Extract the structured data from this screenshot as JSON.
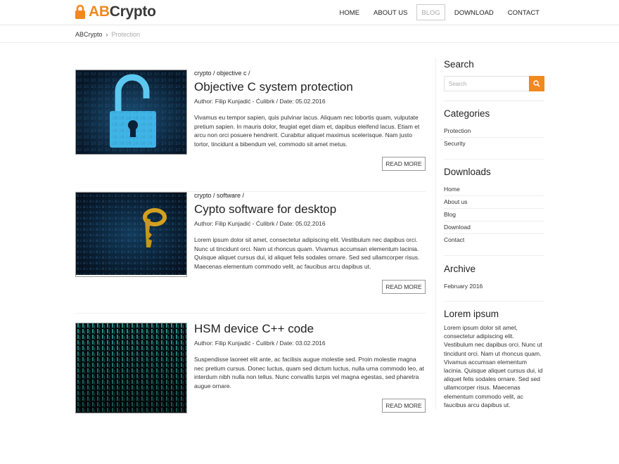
{
  "brand": {
    "ab": "AB",
    "crypto": "Crypto",
    "accent": "#f0891e"
  },
  "nav": {
    "home": "HOME",
    "about": "ABOUT US",
    "blog": "BLOG",
    "download": "DOWNLOAD",
    "contact": "CONTACT",
    "active": "blog"
  },
  "breadcrumb": {
    "root": "ABCrypto",
    "separator": "›",
    "current": "Protection"
  },
  "posts": [
    {
      "cats": "crypto / objective c /",
      "title": "Objective C system protection",
      "meta": "Author: Filip Kunjadić - Ćulibrk / Date: 05.02.2016",
      "text": "Vivamus eu tempor sapien, quis pulvinar lacus. Aliquam nec lobortis quam, vulputate pretium sapien. In mauris dolor, feugiat eget diam et, dapibus eleifend lacus. Etiam et arcu non orci posuere hendrerit. Curabitur aliquet maximus scelerisque. Nam justo tortor, tincidunt a bibendum vel, commodo sit amet metus.",
      "read_more": "READ MORE",
      "image": "padlock-digital"
    },
    {
      "cats": "crypto / software /",
      "title": "Cypto software for desktop",
      "meta": "Author: Filip Kunjadić - Ćulibrk / Date: 05.02.2016",
      "text": "Lorem ipsum dolor sit amet, consectetur adipiscing elit. Vestibulum nec dapibus orci. Nunc ut tincidunt orci. Nam ut rhoncus quam. Vivamus accumsan elementum lacinia. Quisque aliquet cursus dui, id aliquet felis sodales ornare. Sed sed ullamcorper risus. Maecenas elementum commodo velit, ac faucibus arcu dapibus ut.",
      "read_more": "READ MORE",
      "image": "golden-key-digital"
    },
    {
      "cats": "",
      "title": "HSM device C++ code",
      "meta": "Author: Filip Kunjadić - Ćulibrk / Date: 03.02.2016",
      "text": "Suspendisse laoreet elit ante, ac facilisis augue molestie sed. Proin molestie magna nec pretium cursus. Donec luctus, quam sed dictum luctus, nulla urna commodo leo, at interdum nibh nulla non tellus. Nunc convallis turpis vel magna egestas, sed pharetra augue ornare.",
      "read_more": "READ MORE",
      "image": "matrix-code"
    }
  ],
  "sidebar": {
    "search": {
      "title": "Search",
      "placeholder": "Search",
      "icon": "search-icon"
    },
    "categories": {
      "title": "Categories",
      "items": [
        "Protection",
        "Security"
      ]
    },
    "downloads": {
      "title": "Downloads",
      "items": [
        "Home",
        "About us",
        "Blog",
        "Download",
        "Contact"
      ]
    },
    "archive": {
      "title": "Archive",
      "items": [
        "February 2016"
      ]
    },
    "lorem": {
      "title": "Lorem ipsum",
      "text": "Lorem ipsum dolor sit amet, consectetur adipiscing elit. Vestibulum nec dapibus orci. Nunc ut tincidunt orci. Nam ut rhoncus quam. Vivamus accumsan elementum lacinia. Quisque aliquet cursus dui, id aliquet felis sodales ornare. Sed sed ullamcorper risus. Maecenas elementum commodo velit, ac faucibus arcu dapibus ut."
    }
  }
}
